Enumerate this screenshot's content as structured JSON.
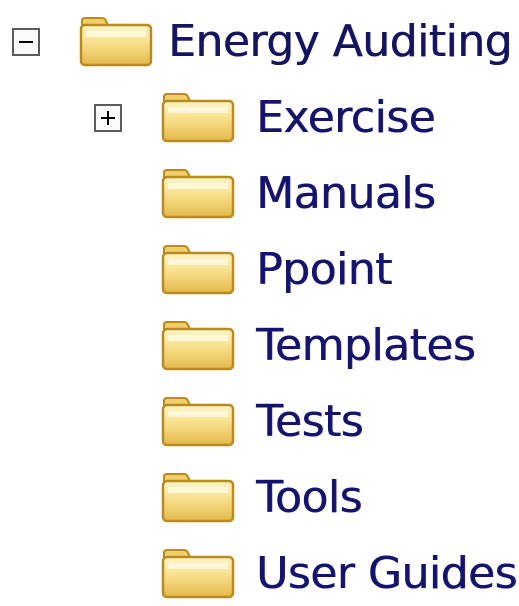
{
  "tree": {
    "root": {
      "label": "Energy Auditing",
      "toggle": "minus",
      "icon": "folder-icon",
      "expanded": true
    },
    "children": [
      {
        "label": "Exercise",
        "toggle": "plus",
        "icon": "folder-icon",
        "expanded": false
      },
      {
        "label": "Manuals",
        "icon": "folder-icon"
      },
      {
        "label": "Ppoint",
        "icon": "folder-icon"
      },
      {
        "label": "Templates",
        "icon": "folder-icon"
      },
      {
        "label": "Tests",
        "icon": "folder-icon"
      },
      {
        "label": "Tools",
        "icon": "folder-icon"
      },
      {
        "label": "User Guides",
        "icon": "folder-icon"
      }
    ]
  },
  "colors": {
    "label_text": "#14146e",
    "folder_body": "#f3d77a",
    "folder_outline": "#b98a1e",
    "toggle_border": "#5a5a5a"
  }
}
